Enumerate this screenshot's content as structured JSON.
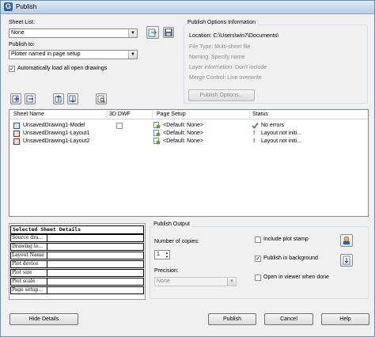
{
  "window": {
    "title": "Publish",
    "app_icon": "G"
  },
  "sheet_list": {
    "label": "Sheet List:",
    "value": "None",
    "load_icon": "load-sheet-list-icon",
    "save_icon": "save-sheet-list-icon"
  },
  "publish_to": {
    "label": "Publish to:",
    "value": "Plotter named in page setup"
  },
  "auto_load": {
    "label": "Automatically load all open drawings",
    "checked": true
  },
  "publish_info": {
    "title": "Publish Options Information",
    "location": "Location:  C:\\Users\\win7\\Documents\\",
    "file_type": "File Type:  Multi-sheet file",
    "naming": "Naming:  Specify name",
    "layer_info": "Layer information:  Don't include",
    "merge_control": "Merge Control:  Line overwrite",
    "options_button": "Publish Options..."
  },
  "list": {
    "columns": [
      "Sheet Name",
      "3D DWF",
      "Page Setup",
      "Status"
    ],
    "rows": [
      {
        "name": "UnsavedDrawing1-Model",
        "dwf": "",
        "setup": "<Default: None>",
        "status": "No errors",
        "status_icon": "check-icon",
        "show_dwf_checkbox": true
      },
      {
        "name": "UnsavedDrawing1-Layout1",
        "dwf": "",
        "setup": "<Default: None>",
        "status": "Layout not initi...",
        "status_icon": "exclamation-icon",
        "show_dwf_checkbox": false
      },
      {
        "name": "UnsavedDrawing1-Layout2",
        "dwf": "",
        "setup": "<Default: None>",
        "status": "Layout not initi...",
        "status_icon": "exclamation-icon",
        "show_dwf_checkbox": false
      }
    ]
  },
  "details": {
    "title": "Selected Sheet Details",
    "rows": [
      "Source dra...",
      "Drawing lo...",
      "Layout Name",
      "Plot device",
      "Plot size",
      "Plot scale",
      "Page setup..."
    ]
  },
  "publish_output": {
    "title": "Publish Output",
    "copies_label": "Number of copies:",
    "copies_value": "1",
    "precision_label": "Precision:",
    "precision_value": "None",
    "plot_stamp": {
      "label": "Include plot stamp",
      "checked": false
    },
    "background": {
      "label": "Publish in background",
      "checked": true
    },
    "open_viewer": {
      "label": "Open in viewer when done",
      "checked": false
    }
  },
  "buttons": {
    "hide_details": "Hide Details",
    "publish": "Publish",
    "cancel": "Cancel",
    "help": "Help"
  }
}
